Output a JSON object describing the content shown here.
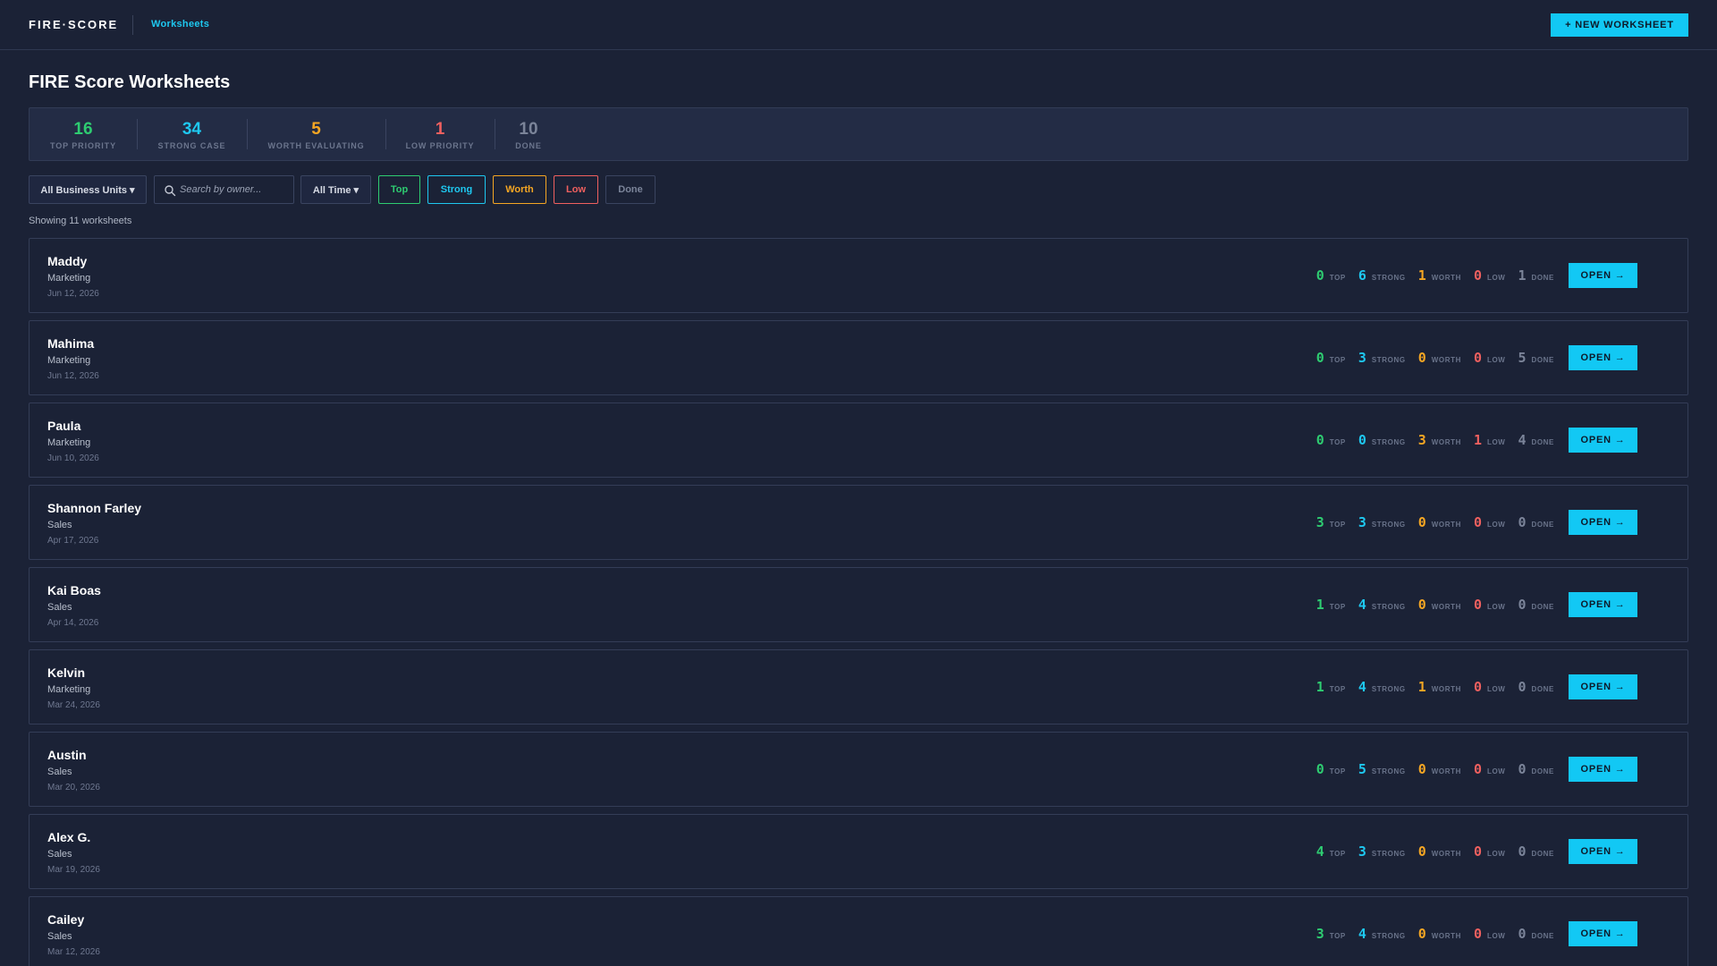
{
  "app": {
    "brand": "FIRE·SCORE",
    "nav_link": "Worksheets",
    "new_button": "+ NEW WORKSHEET"
  },
  "page": {
    "title": "FIRE Score Worksheets",
    "showing": "Showing 11 worksheets"
  },
  "colors": {
    "top": "#2ecc71",
    "strong": "#1ec8f0",
    "worth": "#f5a623",
    "low": "#f0605f",
    "done": "#7b8499",
    "accent": "#12c8f4",
    "background": "#1b2236"
  },
  "stats": [
    {
      "value": "16",
      "label": "TOP PRIORITY",
      "color": "#2ecc71"
    },
    {
      "value": "34",
      "label": "STRONG CASE",
      "color": "#1ec8f0"
    },
    {
      "value": "5",
      "label": "WORTH EVALUATING",
      "color": "#f5a623"
    },
    {
      "value": "1",
      "label": "LOW PRIORITY",
      "color": "#f0605f"
    },
    {
      "value": "10",
      "label": "DONE",
      "color": "#7b8499"
    }
  ],
  "filters": {
    "business_units": "All Business Units ▾",
    "search_placeholder": "Search by owner...",
    "search_icon": "search-icon",
    "time": "All Time ▾",
    "chips": [
      {
        "label": "Top",
        "color": "#2ecc71"
      },
      {
        "label": "Strong",
        "color": "#1ec8f0"
      },
      {
        "label": "Worth",
        "color": "#f5a623"
      },
      {
        "label": "Low",
        "color": "#f0605f"
      },
      {
        "label": "Done",
        "color": "#7b8499"
      }
    ]
  },
  "count_labels": {
    "top": "TOP",
    "strong": "STRONG",
    "worth": "WORTH",
    "low": "LOW",
    "done": "DONE"
  },
  "open_label": "OPEN →",
  "worksheets": [
    {
      "name": "Maddy",
      "unit": "Marketing",
      "date": "Jun 12, 2026",
      "top": "0",
      "strong": "6",
      "worth": "1",
      "low": "0",
      "done": "1"
    },
    {
      "name": "Mahima",
      "unit": "Marketing",
      "date": "Jun 12, 2026",
      "top": "0",
      "strong": "3",
      "worth": "0",
      "low": "0",
      "done": "5"
    },
    {
      "name": "Paula",
      "unit": "Marketing",
      "date": "Jun 10, 2026",
      "top": "0",
      "strong": "0",
      "worth": "3",
      "low": "1",
      "done": "4"
    },
    {
      "name": "Shannon Farley",
      "unit": "Sales",
      "date": "Apr 17, 2026",
      "top": "3",
      "strong": "3",
      "worth": "0",
      "low": "0",
      "done": "0"
    },
    {
      "name": "Kai Boas",
      "unit": "Sales",
      "date": "Apr 14, 2026",
      "top": "1",
      "strong": "4",
      "worth": "0",
      "low": "0",
      "done": "0"
    },
    {
      "name": "Kelvin",
      "unit": "Marketing",
      "date": "Mar 24, 2026",
      "top": "1",
      "strong": "4",
      "worth": "1",
      "low": "0",
      "done": "0"
    },
    {
      "name": "Austin",
      "unit": "Sales",
      "date": "Mar 20, 2026",
      "top": "0",
      "strong": "5",
      "worth": "0",
      "low": "0",
      "done": "0"
    },
    {
      "name": "Alex G.",
      "unit": "Sales",
      "date": "Mar 19, 2026",
      "top": "4",
      "strong": "3",
      "worth": "0",
      "low": "0",
      "done": "0"
    },
    {
      "name": "Cailey",
      "unit": "Sales",
      "date": "Mar 12, 2026",
      "top": "3",
      "strong": "4",
      "worth": "0",
      "low": "0",
      "done": "0"
    }
  ]
}
